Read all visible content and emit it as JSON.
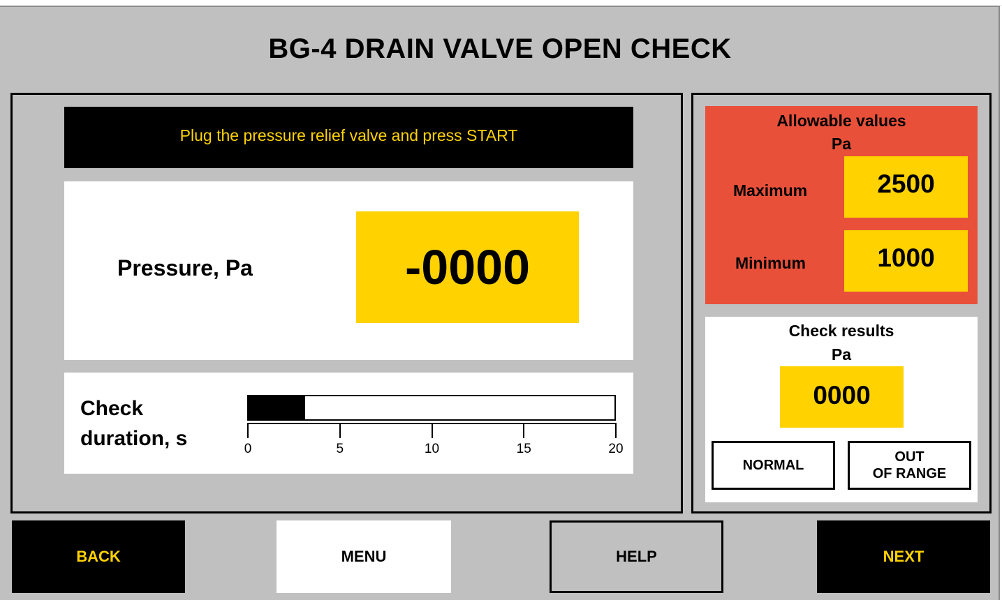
{
  "header": {
    "title": "BG-4 DRAIN VALVE OPEN CHECK"
  },
  "message": {
    "text": "Plug the pressure relief valve and press START"
  },
  "pressure": {
    "label": "Pressure, Pa",
    "value": "-0000"
  },
  "duration": {
    "label_line1": "Check",
    "label_line2": "duration, s",
    "progress_fraction": 0.155,
    "axis_ticks": [
      "0",
      "5",
      "10",
      "15",
      "20"
    ],
    "axis_max": 20
  },
  "allowable": {
    "title_line1": "Allowable values",
    "title_line2": "Pa",
    "maximum_label": "Maximum",
    "maximum_value": "2500",
    "minimum_label": "Minimum",
    "minimum_value": "1000"
  },
  "results": {
    "title_line1": "Check results",
    "title_line2": "Pa",
    "value": "0000",
    "normal_label": "NORMAL",
    "out_line1": "OUT",
    "out_line2": "OF RANGE"
  },
  "nav": {
    "back": "BACK",
    "menu": "MENU",
    "help": "HELP",
    "next": "NEXT"
  },
  "colors": {
    "background": "#c0c0c0",
    "accent_yellow": "#ffd200",
    "alert_red": "#e8503a",
    "black": "#000000",
    "white": "#ffffff"
  }
}
